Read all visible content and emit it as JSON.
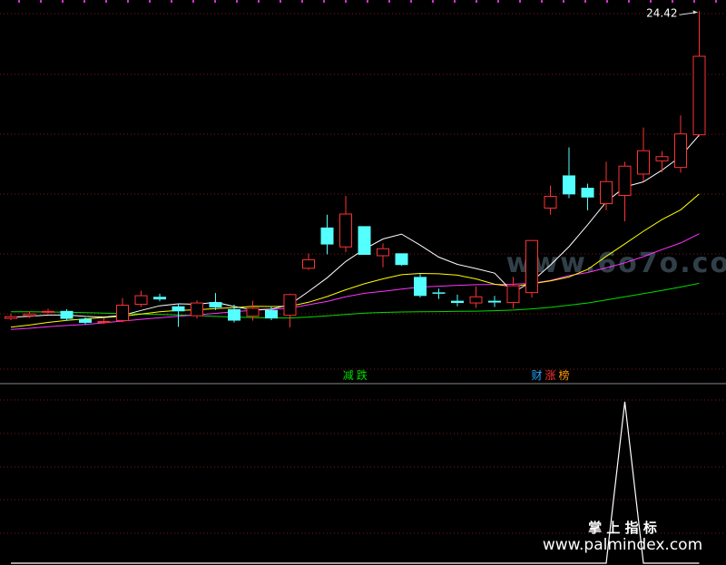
{
  "chart_data": {
    "type": "candlestick",
    "price_axis": {
      "min": 9.6,
      "max": 24.6
    },
    "last_price_label": "24.42",
    "candles": [
      {
        "o": 10.48,
        "c": 10.6,
        "h": 10.72,
        "l": 10.42
      },
      {
        "o": 10.6,
        "c": 10.72,
        "h": 10.82,
        "l": 10.52
      },
      {
        "o": 10.78,
        "c": 10.84,
        "h": 10.94,
        "l": 10.72
      },
      {
        "o": 10.84,
        "c": 10.48,
        "h": 10.92,
        "l": 10.42
      },
      {
        "o": 10.48,
        "c": 10.3,
        "h": 10.54,
        "l": 10.22
      },
      {
        "o": 10.3,
        "c": 10.38,
        "h": 10.52,
        "l": 10.26
      },
      {
        "o": 10.38,
        "c": 11.12,
        "h": 11.42,
        "l": 10.32
      },
      {
        "o": 11.12,
        "c": 11.55,
        "h": 11.75,
        "l": 11.02
      },
      {
        "o": 11.48,
        "c": 11.36,
        "h": 11.62,
        "l": 11.28
      },
      {
        "o": 11.05,
        "c": 10.82,
        "h": 11.18,
        "l": 10.12
      },
      {
        "o": 10.6,
        "c": 11.22,
        "h": 11.32,
        "l": 10.5
      },
      {
        "o": 11.24,
        "c": 11.0,
        "h": 11.65,
        "l": 10.88
      },
      {
        "o": 10.92,
        "c": 10.4,
        "h": 11.12,
        "l": 10.32
      },
      {
        "o": 10.58,
        "c": 10.98,
        "h": 11.3,
        "l": 10.4
      },
      {
        "o": 10.88,
        "c": 10.5,
        "h": 11.05,
        "l": 10.42
      },
      {
        "o": 10.62,
        "c": 11.6,
        "h": 11.62,
        "l": 10.1
      },
      {
        "o": 12.75,
        "c": 13.18,
        "h": 13.45,
        "l": 12.7
      },
      {
        "o": 14.62,
        "c": 13.85,
        "h": 15.2,
        "l": 13.4
      },
      {
        "o": 13.72,
        "c": 15.25,
        "h": 16.05,
        "l": 13.5
      },
      {
        "o": 14.68,
        "c": 13.38,
        "h": 14.68,
        "l": 13.38
      },
      {
        "o": 13.32,
        "c": 13.68,
        "h": 13.9,
        "l": 12.82
      },
      {
        "o": 13.45,
        "c": 12.92,
        "h": 13.45,
        "l": 12.88
      },
      {
        "o": 12.38,
        "c": 11.52,
        "h": 12.5,
        "l": 11.45
      },
      {
        "o": 11.68,
        "c": 11.62,
        "h": 11.85,
        "l": 11.38
      },
      {
        "o": 11.3,
        "c": 11.2,
        "h": 11.58,
        "l": 11.05
      },
      {
        "o": 11.18,
        "c": 11.5,
        "h": 11.95,
        "l": 10.98
      },
      {
        "o": 11.3,
        "c": 11.22,
        "h": 11.52,
        "l": 11.02
      },
      {
        "o": 11.2,
        "c": 12.0,
        "h": 12.38,
        "l": 10.95
      },
      {
        "o": 11.65,
        "c": 14.05,
        "h": 14.05,
        "l": 11.45
      },
      {
        "o": 15.48,
        "c": 16.05,
        "h": 16.52,
        "l": 15.2
      },
      {
        "o": 16.98,
        "c": 16.12,
        "h": 18.25,
        "l": 15.95
      },
      {
        "o": 16.42,
        "c": 15.98,
        "h": 16.6,
        "l": 15.4
      },
      {
        "o": 15.68,
        "c": 16.72,
        "h": 17.6,
        "l": 15.4
      },
      {
        "o": 16.05,
        "c": 17.42,
        "h": 17.6,
        "l": 14.9
      },
      {
        "o": 17.02,
        "c": 18.12,
        "h": 19.15,
        "l": 16.7
      },
      {
        "o": 17.62,
        "c": 17.85,
        "h": 18.08,
        "l": 17.12
      },
      {
        "o": 17.32,
        "c": 18.88,
        "h": 19.7,
        "l": 17.1
      },
      {
        "o": 18.8,
        "c": 22.4,
        "h": 24.42,
        "l": 18.75
      }
    ],
    "moving_averages": [
      {
        "name": "MA5",
        "color": "#ffffff",
        "values": [
          10.55,
          10.6,
          10.65,
          10.65,
          10.59,
          10.56,
          10.64,
          10.86,
          11.07,
          11.16,
          11.14,
          11.23,
          11.04,
          10.89,
          10.92,
          11.13,
          11.72,
          12.34,
          13.08,
          13.64,
          14.1,
          14.32,
          13.82,
          13.28,
          12.95,
          12.76,
          12.55,
          11.68,
          12.17,
          12.92,
          13.75,
          14.74,
          15.78,
          16.46,
          16.69,
          17.22,
          17.84,
          18.81
        ]
      },
      {
        "name": "MA10",
        "color": "#ffff00",
        "values": [
          10.1,
          10.2,
          10.32,
          10.41,
          10.48,
          10.54,
          10.6,
          10.7,
          10.8,
          10.86,
          10.89,
          10.95,
          10.99,
          11.05,
          11.04,
          11.05,
          11.23,
          11.49,
          11.8,
          12.07,
          12.29,
          12.48,
          12.54,
          12.52,
          12.46,
          12.29,
          12.05,
          11.94,
          12.07,
          12.2,
          12.38,
          12.72,
          13.31,
          13.88,
          14.45,
          14.98,
          15.42,
          16.14
        ]
      },
      {
        "name": "MA20",
        "color": "#ff33ff",
        "values": [
          10.0,
          10.05,
          10.12,
          10.18,
          10.23,
          10.3,
          10.38,
          10.46,
          10.53,
          10.6,
          10.66,
          10.73,
          10.8,
          10.87,
          10.91,
          10.96,
          11.12,
          11.27,
          11.48,
          11.64,
          11.73,
          11.83,
          11.92,
          11.96,
          12.0,
          12.03,
          12.04,
          12.05,
          12.09,
          12.22,
          12.44,
          12.58,
          12.79,
          13.02,
          13.3,
          13.62,
          13.92,
          14.34
        ]
      },
      {
        "name": "MA60",
        "color": "#00dd00",
        "values": [
          10.8,
          10.8,
          10.79,
          10.78,
          10.76,
          10.74,
          10.72,
          10.7,
          10.68,
          10.66,
          10.63,
          10.59,
          10.56,
          10.54,
          10.52,
          10.52,
          10.56,
          10.62,
          10.68,
          10.74,
          10.77,
          10.79,
          10.8,
          10.81,
          10.82,
          10.83,
          10.85,
          10.88,
          10.93,
          11.0,
          11.1,
          11.2,
          11.34,
          11.48,
          11.62,
          11.77,
          11.92,
          12.09
        ]
      }
    ],
    "signal_labels": [
      {
        "index": 18.5,
        "segments": [
          {
            "text": "减",
            "color": "#00dd00"
          },
          {
            "text": "跌",
            "color": "#00dd00"
          }
        ]
      },
      {
        "index": 29,
        "segments": [
          {
            "text": "财",
            "color": "#22aaff"
          },
          {
            "text": "涨",
            "color": "#ff3333"
          },
          {
            "text": "榜",
            "color": "#ff9900"
          }
        ]
      }
    ],
    "indicator": {
      "type": "line",
      "color": "#ffffff",
      "ylim": [
        0,
        1
      ],
      "values": [
        0,
        0,
        0,
        0,
        0,
        0,
        0,
        0,
        0,
        0,
        0,
        0,
        0,
        0,
        0,
        0,
        0,
        0,
        0,
        0,
        0,
        0,
        0,
        0,
        0,
        0,
        0,
        0,
        0,
        0,
        0,
        0,
        0,
        1,
        0,
        0,
        0,
        0
      ]
    }
  },
  "watermark_text": "www.6o7o.com",
  "footer_watermark": {
    "title": "掌 上 指 标",
    "url": "www.palmindex.com"
  },
  "colors": {
    "up": "#ff3232",
    "down": "#54ffff",
    "grid": "#7a1a1a",
    "background": "#000000"
  }
}
